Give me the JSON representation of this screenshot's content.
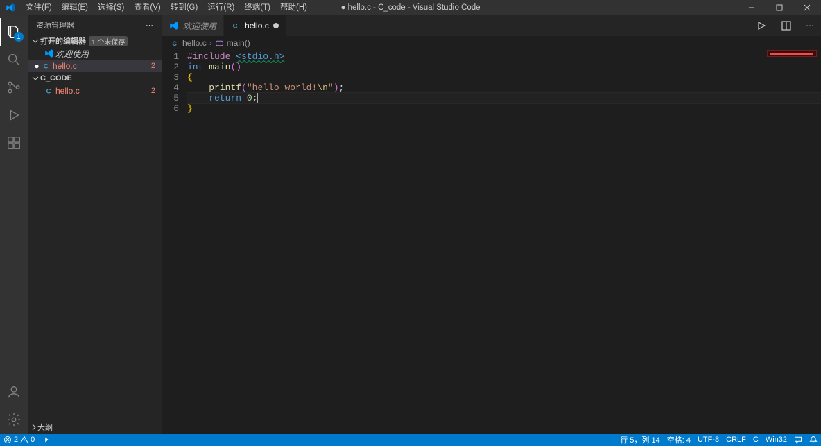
{
  "window": {
    "title": "● hello.c - C_code - Visual Studio Code"
  },
  "menu": [
    {
      "label": "文件(F)"
    },
    {
      "label": "编辑(E)"
    },
    {
      "label": "选择(S)"
    },
    {
      "label": "查看(V)"
    },
    {
      "label": "转到(G)"
    },
    {
      "label": "运行(R)"
    },
    {
      "label": "终端(T)"
    },
    {
      "label": "帮助(H)"
    }
  ],
  "activitybar": {
    "explorer_badge": "1"
  },
  "sidebar": {
    "title": "资源管理器",
    "open_editors": {
      "label": "打开的编辑器",
      "unsaved_badge": "1 个未保存",
      "items": [
        {
          "name": "欢迎使用",
          "kind": "welcome"
        },
        {
          "name": "hello.c",
          "kind": "c",
          "dirty": true,
          "errors": "2"
        }
      ]
    },
    "folder": {
      "label": "C_CODE",
      "items": [
        {
          "name": "hello.c",
          "kind": "c",
          "errors": "2"
        }
      ]
    },
    "outline_label": "大纲"
  },
  "tabs": [
    {
      "label": "欢迎使用",
      "kind": "welcome",
      "active": false
    },
    {
      "label": "hello.c",
      "kind": "c",
      "active": true,
      "dirty": true
    }
  ],
  "breadcrumb": {
    "file": "hello.c",
    "symbol": "main()"
  },
  "code": {
    "lines": [
      {
        "n": "1",
        "tokens": [
          [
            "preproc",
            "#include"
          ],
          [
            "default",
            " "
          ],
          [
            "include",
            "<stdio.h>"
          ]
        ]
      },
      {
        "n": "2",
        "tokens": [
          [
            "keyword",
            "int"
          ],
          [
            "default",
            " "
          ],
          [
            "func",
            "main"
          ],
          [
            "paren",
            "()"
          ]
        ]
      },
      {
        "n": "3",
        "tokens": [
          [
            "brace",
            "{"
          ]
        ]
      },
      {
        "n": "4",
        "tokens": [
          [
            "default",
            "    "
          ],
          [
            "func",
            "printf"
          ],
          [
            "paren",
            "("
          ],
          [
            "string",
            "\"hello world!"
          ],
          [
            "escape",
            "\\n"
          ],
          [
            "string",
            "\""
          ],
          [
            "paren",
            ")"
          ],
          [
            "punc",
            ";"
          ]
        ]
      },
      {
        "n": "5",
        "current": true,
        "cursor": true,
        "tokens": [
          [
            "default",
            "    "
          ],
          [
            "keyword",
            "return"
          ],
          [
            "default",
            " "
          ],
          [
            "num",
            "0"
          ],
          [
            "punc",
            ";"
          ]
        ]
      },
      {
        "n": "6",
        "tokens": [
          [
            "brace",
            "}"
          ]
        ]
      }
    ]
  },
  "statusbar": {
    "errors": "2",
    "warnings": "0",
    "line_col": "行 5，列 14",
    "spaces": "空格: 4",
    "encoding": "UTF-8",
    "eol": "CRLF",
    "language": "C",
    "platform": "Win32"
  },
  "colors": {
    "c_icon": "#519aba"
  }
}
